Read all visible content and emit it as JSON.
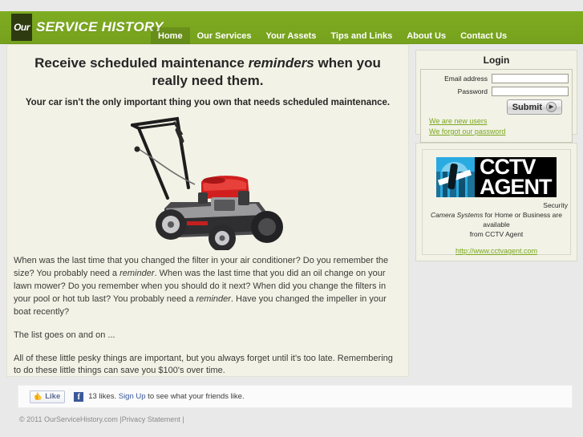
{
  "header": {
    "logo_badge": "Our",
    "logo_word": "SERVICE HISTORY",
    "nav": [
      {
        "label": "Home",
        "active": true
      },
      {
        "label": "Our Services",
        "active": false
      },
      {
        "label": "Your Assets",
        "active": false
      },
      {
        "label": "Tips and Links",
        "active": false
      },
      {
        "label": "About Us",
        "active": false
      },
      {
        "label": "Contact Us",
        "active": false
      }
    ]
  },
  "main": {
    "headline_part1": "Receive scheduled maintenance ",
    "headline_em": "reminders",
    "headline_part2": " when you really need them.",
    "subhead": "Your car isn't the only important thing you own that needs scheduled maintenance.",
    "hero_alt": "lawn-mower-photo",
    "paragraph1_a": "When was the last time that you changed the filter in your air conditioner? Do you remember the size? You probably need a ",
    "paragraph1_em1": "reminder",
    "paragraph1_b": ". When was the last time that you did an oil change on your lawn mower? Do you remember when you should do it next? When did you change the filters in your pool or hot tub last? You probably need a ",
    "paragraph1_em2": "reminder",
    "paragraph1_c": ". Have you changed the impeller in your boat recently?",
    "paragraph2": "The list goes on and on ...",
    "paragraph3": "All of these little pesky things are important, but you always forget until it's too late. Remembering to do these little things can save you $100's over time."
  },
  "login": {
    "title": "Login",
    "email_label": "Email address",
    "email_value": "",
    "email_placeholder": "",
    "password_label": "Password",
    "password_value": "",
    "password_placeholder": "",
    "submit_label": "Submit",
    "submit_icon": "▶",
    "new_users_link": "We are new users",
    "forgot_link": "We forgot our password",
    "link_color": "#7aa81f"
  },
  "ad": {
    "logo_line1": "CCTV",
    "logo_line2": "AGENT",
    "copy_line1": "Security",
    "copy_em": "Camera Systems",
    "copy_line2": " for Home or Business are available",
    "copy_line3": "from CCTV Agent",
    "url": "http://www.cctvagent.com",
    "logo_bg": "#000000",
    "glyph_color": "#29abe2"
  },
  "facebook": {
    "like_label": "Like",
    "thumb_icon": "👍",
    "f_icon": "f",
    "likes_text_a": "13 likes. ",
    "signup_link": "Sign Up",
    "likes_text_b": " to see what your friends like."
  },
  "footer": {
    "copyright": "© 2011 OurServiceHistory.com |",
    "privacy_link": "Privacy Statement",
    "tail": " |"
  },
  "colors": {
    "brand_green": "#7aa81f",
    "panel_cream": "#f2f2e6",
    "page_gray": "#e9e9e9"
  }
}
